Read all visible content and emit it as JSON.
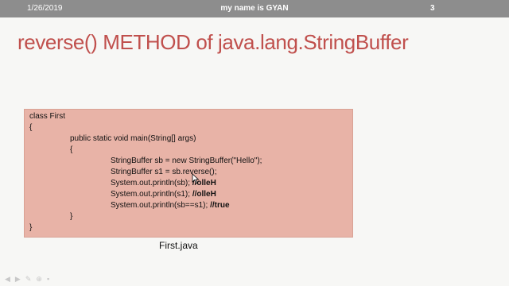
{
  "header": {
    "date": "1/26/2019",
    "center_text": "my name is GYAN",
    "slide_number": "3"
  },
  "slide": {
    "title": "reverse() METHOD of java.lang.StringBuffer",
    "code_lines": [
      {
        "code": "class First",
        "comment": ""
      },
      {
        "code": "{",
        "comment": ""
      },
      {
        "code": "public static void main(String[] args)",
        "comment": ""
      },
      {
        "code": "{",
        "comment": ""
      },
      {
        "code": "StringBuffer sb = new StringBuffer(\"Hello\");",
        "comment": ""
      },
      {
        "code": "StringBuffer s1 = sb.reverse();",
        "comment": ""
      },
      {
        "code": "System.out.println(sb); ",
        "comment": "//olleH"
      },
      {
        "code": "System.out.println(s1); ",
        "comment": "//olleH"
      },
      {
        "code": "System.out.println(sb==s1); ",
        "comment": "//true"
      },
      {
        "code": "}",
        "comment": ""
      },
      {
        "code": "}",
        "comment": ""
      }
    ],
    "caption": "First.java"
  },
  "controls": {
    "icons": [
      "prev-icon",
      "next-icon",
      "pen-icon",
      "zoom-icon",
      "menu-icon"
    ]
  },
  "colors": {
    "header_bg": "#8d8d8d",
    "title": "#c0504d",
    "code_bg": "#e8b3a7"
  }
}
